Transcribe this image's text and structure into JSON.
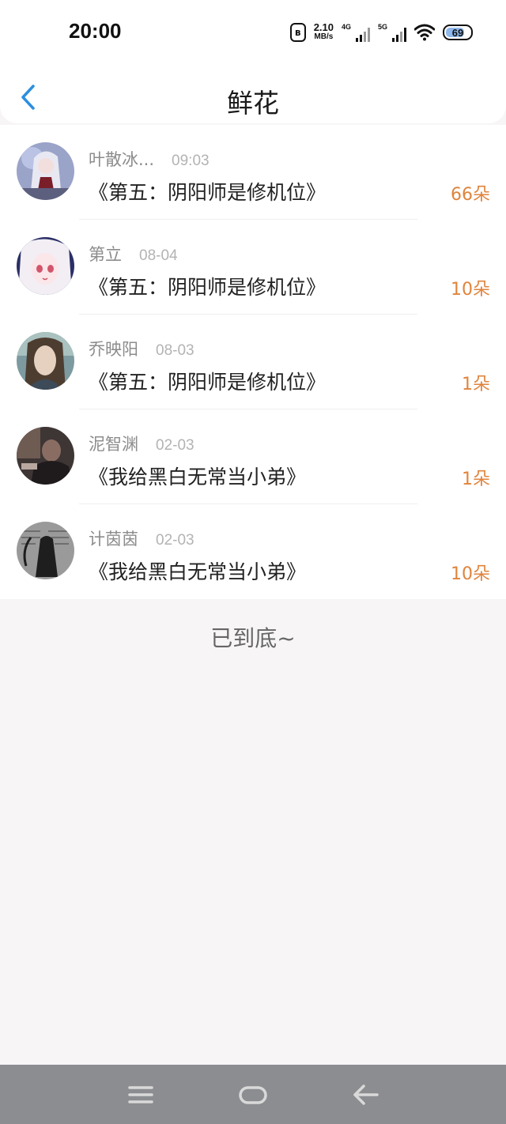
{
  "status_bar": {
    "time": "20:00",
    "net_speed_value": "2.10",
    "net_speed_unit": "MB/s",
    "sim1_tag": "4G",
    "sim2_tag": "5G",
    "battery": "69",
    "icons": [
      "bluetooth-icon",
      "signal-4g-icon",
      "signal-5g-icon",
      "wifi-icon",
      "battery-icon"
    ]
  },
  "header": {
    "title": "鲜花",
    "back_icon": "chevron-left-icon",
    "accent_color": "#2b8fe0"
  },
  "items": [
    {
      "name": "叶散冰...",
      "date": "09:03",
      "book": "《第五：阴阳师是修机位》",
      "count": "66朵",
      "avatar": "anime-girl-white-hair"
    },
    {
      "name": "第立",
      "date": "08-04",
      "book": "《第五：阴阳师是修机位》",
      "count": "10朵",
      "avatar": "anime-girl-pink-eyes"
    },
    {
      "name": "乔映阳",
      "date": "08-03",
      "book": "《第五：阴阳师是修机位》",
      "count": "1朵",
      "avatar": "woman-portrait"
    },
    {
      "name": "泥智渊",
      "date": "02-03",
      "book": "《我给黑白无常当小弟》",
      "count": "1朵",
      "avatar": "dark-photo"
    },
    {
      "name": "计茵茵",
      "date": "02-03",
      "book": "《我给黑白无常当小弟》",
      "count": "10朵",
      "avatar": "grim-reaper-calligraphy"
    }
  ],
  "footer_text": "已到底~",
  "colors": {
    "count": "#e0843c",
    "background": "#f7f5f6",
    "nav_bar": "#8c8d90"
  },
  "system_nav": [
    "menu-icon",
    "home-icon",
    "back-arrow-icon"
  ]
}
